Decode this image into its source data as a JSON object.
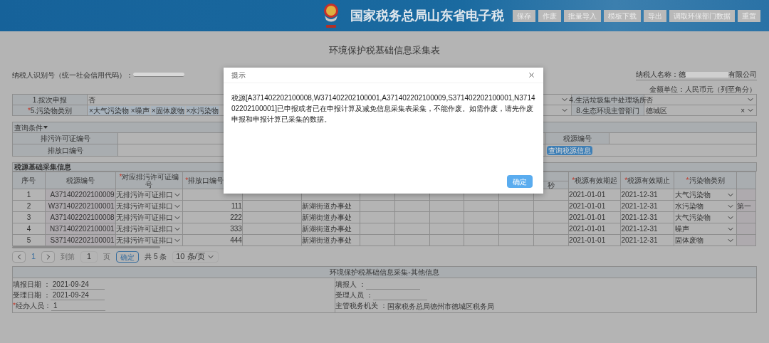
{
  "header": {
    "title": "国家税务总局山东省电子税",
    "buttons": [
      "保存",
      "作废",
      "批量导入",
      "模板下载",
      "导出",
      "调取环保部门数据",
      "重置"
    ]
  },
  "page_title": "环境保护税基础信息采集表",
  "taxpayer": {
    "id_label": "纳税人识别号（统一社会信用代码）：",
    "name_label": "纳税人名称：",
    "name_start": "德",
    "name_end": "有限公司"
  },
  "currency_note": "金额单位：人民币元（列至角分）",
  "form": [
    {
      "label": "1.按次申报",
      "required": false,
      "value": "否",
      "right_label": "4.生活垃圾集中处理场所",
      "right_value": "否",
      "clearable": false
    },
    {
      "label": "5.污染物类别",
      "required": true,
      "tags": [
        "大气污染物",
        "噪声",
        "固体废物",
        "水污染物"
      ],
      "right_label": "8.生态环境主管部门",
      "right_value": "德城区",
      "clearable": true
    }
  ],
  "required_mark": "*",
  "tag_remove": "×",
  "clear_mark": "×",
  "query": {
    "title": "查询条件",
    "fields": [
      "排污许可证编号",
      "排放口编号",
      "税源编号"
    ],
    "button": "查询税源信息"
  },
  "section_title": "税源基础采集信息",
  "columns": [
    {
      "label": "序号",
      "required": false
    },
    {
      "label": "税源编号",
      "required": false
    },
    {
      "label": "对应排污许可证编号",
      "required": true
    },
    {
      "label": "排放口编号",
      "required": true
    },
    {
      "sublabel": "秒"
    },
    {
      "label": "税源有效期起",
      "required": true
    },
    {
      "label": "税源有效期止",
      "required": true
    },
    {
      "label": "污染物类别",
      "required": true
    },
    {}
  ],
  "rows": [
    {
      "no": "1",
      "source_id": "A371402202100009",
      "permit": "无排污许可证排口",
      "start": "2021-01-01",
      "end": "2021-12-31",
      "pollutant": "大气污染物"
    },
    {
      "no": "2",
      "source_id": "W371402202100001",
      "permit": "无排污许可证排口",
      "outlet": "111",
      "street": "新湖街道办事处",
      "start": "2021-01-01",
      "end": "2021-12-31",
      "pollutant": "水污染物",
      "extra": "第一"
    },
    {
      "no": "3",
      "source_id": "A371402202100008",
      "permit": "无排污许可证排口",
      "outlet": "222",
      "street": "新湖街道办事处",
      "start": "2021-01-01",
      "end": "2021-12-31",
      "pollutant": "大气污染物"
    },
    {
      "no": "4",
      "source_id": "N371402202100001",
      "permit": "无排污许可证排口",
      "outlet": "333",
      "street": "新湖街道办事处",
      "start": "2021-01-01",
      "end": "2021-12-31",
      "pollutant": "噪声"
    },
    {
      "no": "5",
      "source_id": "S371402202100001",
      "permit": "无排污许可证排口",
      "outlet": "444",
      "street": "新湖街道办事处",
      "start": "2021-01-01",
      "end": "2021-12-31",
      "pollutant": "固体废物"
    }
  ],
  "pagination": {
    "current_page": "1",
    "goto_label": "到第",
    "goto_value": "1",
    "page_unit": "页",
    "go_button": "确定",
    "total": "共 5 条",
    "page_size": "10 条/页"
  },
  "other_info": {
    "title": "环境保护税基础信息采集-其他信息",
    "left": [
      {
        "label": "填报日期 ：",
        "value": "2021-09-24",
        "required": false
      },
      {
        "label": "受理日期 ：",
        "value": "2021-09-24",
        "required": false
      },
      {
        "label": "经办人员：",
        "value": "1",
        "required": true
      }
    ],
    "right": [
      {
        "label": "填报人 ："
      },
      {
        "label": "受理人员 ："
      },
      {
        "label": "主管税务机关 ：",
        "value": "国家税务总局德州市德城区税务局"
      }
    ]
  },
  "dialog": {
    "title": "提示",
    "message": "税源[A371402202100008,W371402202100001,A371402202100009,S371402202100001,N371402202100001]已申报或者已在申报计算及减免信息采集表采集，不能作废。如需作废，请先作废申报和申报计算已采集的数据。",
    "button": "确定"
  }
}
